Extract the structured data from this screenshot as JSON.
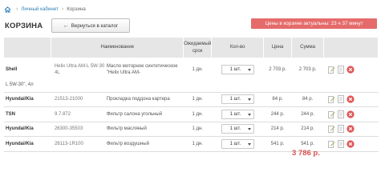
{
  "breadcrumb": {
    "link": "Личный кабинет",
    "current": "Корзина"
  },
  "header": {
    "title": "КОРЗИНА",
    "back_button": "Вернуться в каталог",
    "banner": "Цены в корзине актуальны: 23 ч 37 минут"
  },
  "table": {
    "columns": {
      "name": "Наименование",
      "term": "Ожидаемый срок",
      "qty": "Кол-во",
      "price": "Цена",
      "sum": "Сумма"
    },
    "rows": [
      {
        "brand": "Shell",
        "code": "Helix Ultra AM-L 5W-30 4L",
        "desc": "Масло моторное синтетическое \"Helix Ultra AM-",
        "desc_cont": "L 5W-30\", 4л",
        "term": "1 дн.",
        "qty": "1 шт.",
        "price": "2 703 р.",
        "sum": "2 703 р."
      },
      {
        "brand": "Hyundai/Kia",
        "code": "21513-21000",
        "desc": "Прокладка поддона картера",
        "term": "1 дн.",
        "qty": "1 шт.",
        "price": "84 р.",
        "sum": "84 р."
      },
      {
        "brand": "TSN",
        "code": "9.7.872",
        "desc": "Фильтр салона угольный",
        "term": "1 дн.",
        "qty": "1 шт.",
        "price": "244 р.",
        "sum": "244 р."
      },
      {
        "brand": "Hyundai/Kia",
        "code": "26300-35503",
        "desc": "Фильтр масляный",
        "term": "1 дн.",
        "qty": "1 шт.",
        "price": "214 р.",
        "sum": "214 р."
      },
      {
        "brand": "Hyundai/Kia",
        "code": "28113-1R100",
        "desc": "Фильтр воздушный",
        "term": "1 дн.",
        "qty": "1 шт.",
        "price": "541 р.",
        "sum": "541 р."
      }
    ]
  },
  "total": "3 786 р.",
  "colors": {
    "link": "#2f7fb8",
    "banner_bg": "#e56b6b",
    "total": "#d9534f",
    "header_bg": "#e6e6e6",
    "delete": "#e05555"
  },
  "icons": {
    "home": "home-icon",
    "edit": "edit-icon",
    "note": "note-icon",
    "delete": "delete-icon",
    "back": "arrow-left-icon"
  }
}
